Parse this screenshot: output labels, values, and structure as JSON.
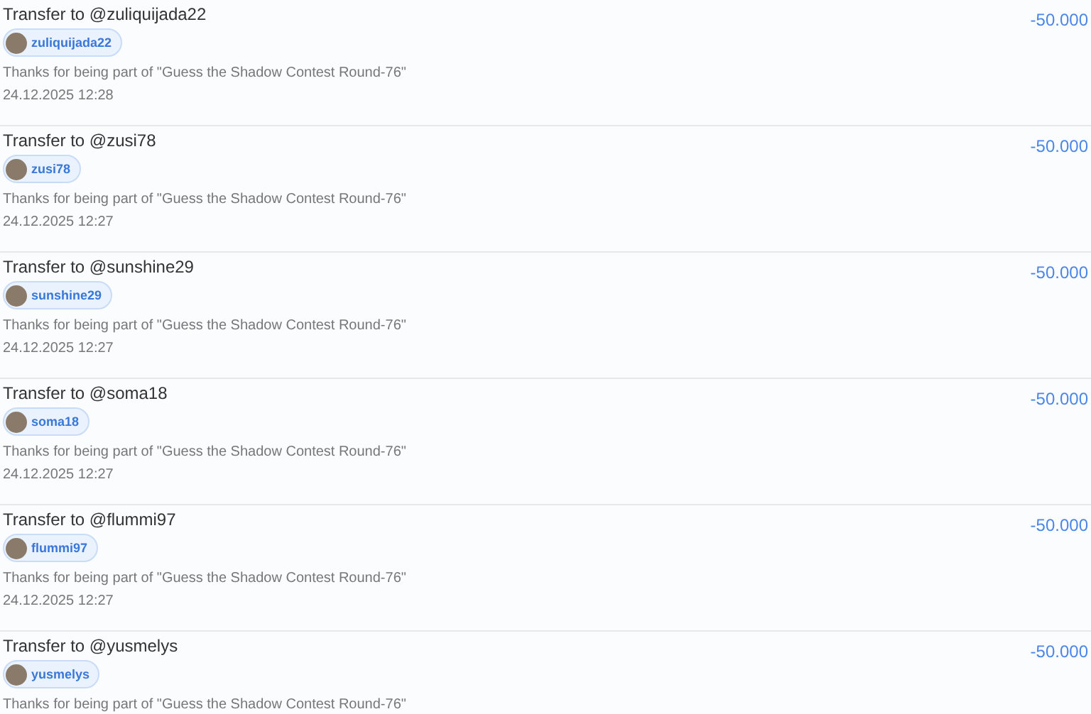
{
  "transfers": [
    {
      "title": "Transfer to @zuliquijada22",
      "user": "zuliquijada22",
      "memo": "Thanks for being part of \"Guess the Shadow Contest Round-76\"",
      "date": "24.12.2025 12:28",
      "amount": "-50.000"
    },
    {
      "title": "Transfer to @zusi78",
      "user": "zusi78",
      "memo": "Thanks for being part of \"Guess the Shadow Contest Round-76\"",
      "date": "24.12.2025 12:27",
      "amount": "-50.000"
    },
    {
      "title": "Transfer to @sunshine29",
      "user": "sunshine29",
      "memo": "Thanks for being part of \"Guess the Shadow Contest Round-76\"",
      "date": "24.12.2025 12:27",
      "amount": "-50.000"
    },
    {
      "title": "Transfer to @soma18",
      "user": "soma18",
      "memo": "Thanks for being part of \"Guess the Shadow Contest Round-76\"",
      "date": "24.12.2025 12:27",
      "amount": "-50.000"
    },
    {
      "title": "Transfer to @flummi97",
      "user": "flummi97",
      "memo": "Thanks for being part of \"Guess the Shadow Contest Round-76\"",
      "date": "24.12.2025 12:27",
      "amount": "-50.000"
    },
    {
      "title": "Transfer to @yusmelys",
      "user": "yusmelys",
      "memo": "Thanks for being part of \"Guess the Shadow Contest Round-76\"",
      "amount": "-50.000"
    }
  ]
}
